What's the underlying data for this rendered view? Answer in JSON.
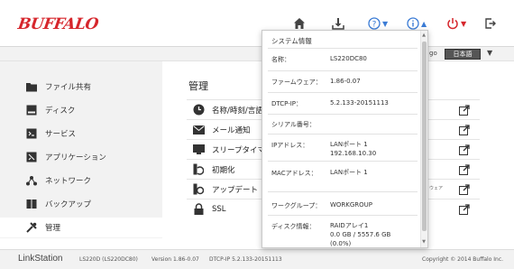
{
  "header": {
    "logo": "BUFFALO",
    "icons": [
      {
        "name": "home-icon"
      },
      {
        "name": "download-icon"
      },
      {
        "name": "help-icon"
      },
      {
        "name": "info-icon"
      },
      {
        "name": "power-icon"
      },
      {
        "name": "logout-icon"
      }
    ],
    "colors": {
      "help": "#3a7bd5",
      "info": "#3a7bd5",
      "power": "#d6262c",
      "brand": "#d6262c"
    }
  },
  "language": {
    "prefix": "go",
    "selected": "日本語"
  },
  "sidebar": {
    "items": [
      {
        "label": "ファイル共有",
        "icon": "folder-icon"
      },
      {
        "label": "ディスク",
        "icon": "disk-icon"
      },
      {
        "label": "サービス",
        "icon": "service-icon"
      },
      {
        "label": "アプリケーション",
        "icon": "application-icon"
      },
      {
        "label": "ネットワーク",
        "icon": "network-icon"
      },
      {
        "label": "バックアップ",
        "icon": "backup-icon"
      },
      {
        "label": "管理",
        "icon": "tools-icon"
      }
    ]
  },
  "main": {
    "title": "管理",
    "rows": [
      {
        "label": "名称/時刻/言語",
        "icon": "clock-icon"
      },
      {
        "label": "メール通知",
        "icon": "mail-icon"
      },
      {
        "label": "スリープタイマー",
        "icon": "sleep-timer-icon"
      },
      {
        "label": "初期化",
        "icon": "reset-icon"
      },
      {
        "label": "アップデート",
        "icon": "update-icon"
      },
      {
        "label": "SSL",
        "icon": "lock-icon"
      }
    ],
    "update_note": "ウェア"
  },
  "popup": {
    "title": "システム情報",
    "rows": [
      {
        "label": "名称：",
        "value": "LS220DC80"
      },
      {
        "label": "ファームウェア：",
        "value": "1.86-0.07"
      },
      {
        "label": "DTCP-IP：",
        "value": "5.2.133-20151113"
      },
      {
        "label": "シリアル番号：",
        "value": ""
      },
      {
        "label": "IPアドレス：",
        "value": "LANポート 1\n192.168.10.30"
      },
      {
        "label": "MACアドレス：",
        "value": "LANポート 1"
      },
      {
        "label": "ワークグループ：",
        "value": "WORKGROUP"
      },
      {
        "label": "ディスク情報：",
        "value": "RAIDアレイ1\n0.0 GB / 5557.6 GB\n(0.0%)"
      }
    ]
  },
  "footer": {
    "brand": "LinkStation",
    "model": "LS220D (LS220DC80)",
    "version": "Version 1.86-0.07",
    "dtcp": "DTCP-IP 5.2.133-20151113",
    "copyright": "Copyright © 2014 Buffalo Inc."
  }
}
